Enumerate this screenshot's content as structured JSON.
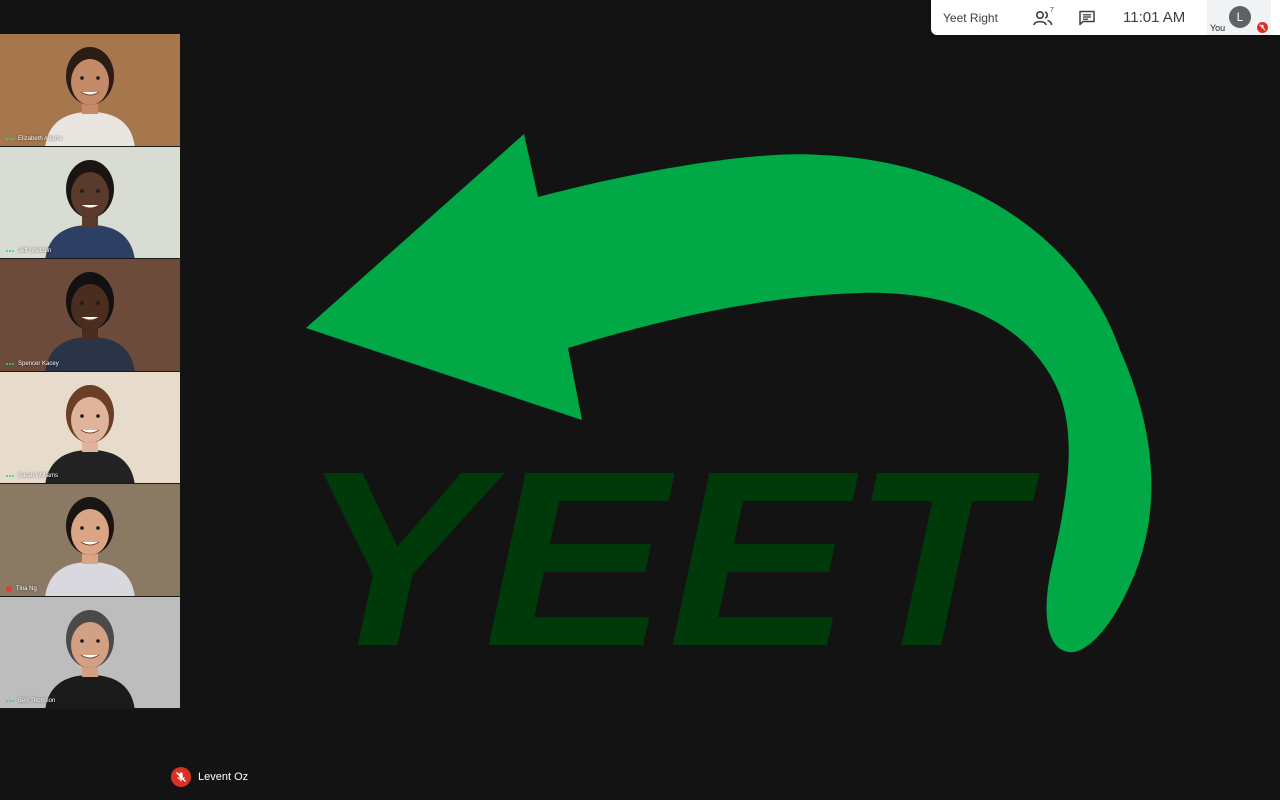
{
  "meeting": {
    "name": "Yeet Right",
    "participant_count": "7",
    "time": "11:01  AM"
  },
  "self": {
    "initial": "L",
    "label": "You",
    "muted": true
  },
  "participants": [
    {
      "name": "Elizabeth Adams",
      "status": "speaking-dots",
      "bg": "#a6764c",
      "shirt": "#e9e6e1",
      "skin": "#c48a68",
      "hair": "#2b1c16"
    },
    {
      "name": "Jeff Sheldon",
      "status": "speaking-dots",
      "bg": "#d9dcd2",
      "shirt": "#2d3f63",
      "skin": "#5a3b2b",
      "hair": "#1a1412"
    },
    {
      "name": "Spencer Kacey",
      "status": "speaking-dots",
      "bg": "#6d4b3a",
      "shirt": "#2b3347",
      "skin": "#4b2d20",
      "hair": "#121010"
    },
    {
      "name": "Sarah Williams",
      "status": "speaking-dots",
      "bg": "#e7dccb",
      "shirt": "#222222",
      "skin": "#e0b49a",
      "hair": "#6b3e25"
    },
    {
      "name": "Tina Ng",
      "status": "muted",
      "bg": "#8a7a63",
      "shirt": "#d8d8de",
      "skin": "#d9a585",
      "hair": "#1a1412"
    },
    {
      "name": "Ben Thomson",
      "status": "speaking-dots",
      "bg": "#bdbdbd",
      "shirt": "#1b1b1b",
      "skin": "#d2a184",
      "hair": "#4a4a4a"
    }
  ],
  "presentation": {
    "text": "YEET",
    "arrow_color": "#00a846",
    "text_color": "#003a0a",
    "background": "#131313"
  },
  "presenter": {
    "name": "Levent Oz",
    "muted": true
  },
  "icons": {
    "people": "people-icon",
    "chat": "chat-icon",
    "mic_off": "mic-off-icon"
  }
}
